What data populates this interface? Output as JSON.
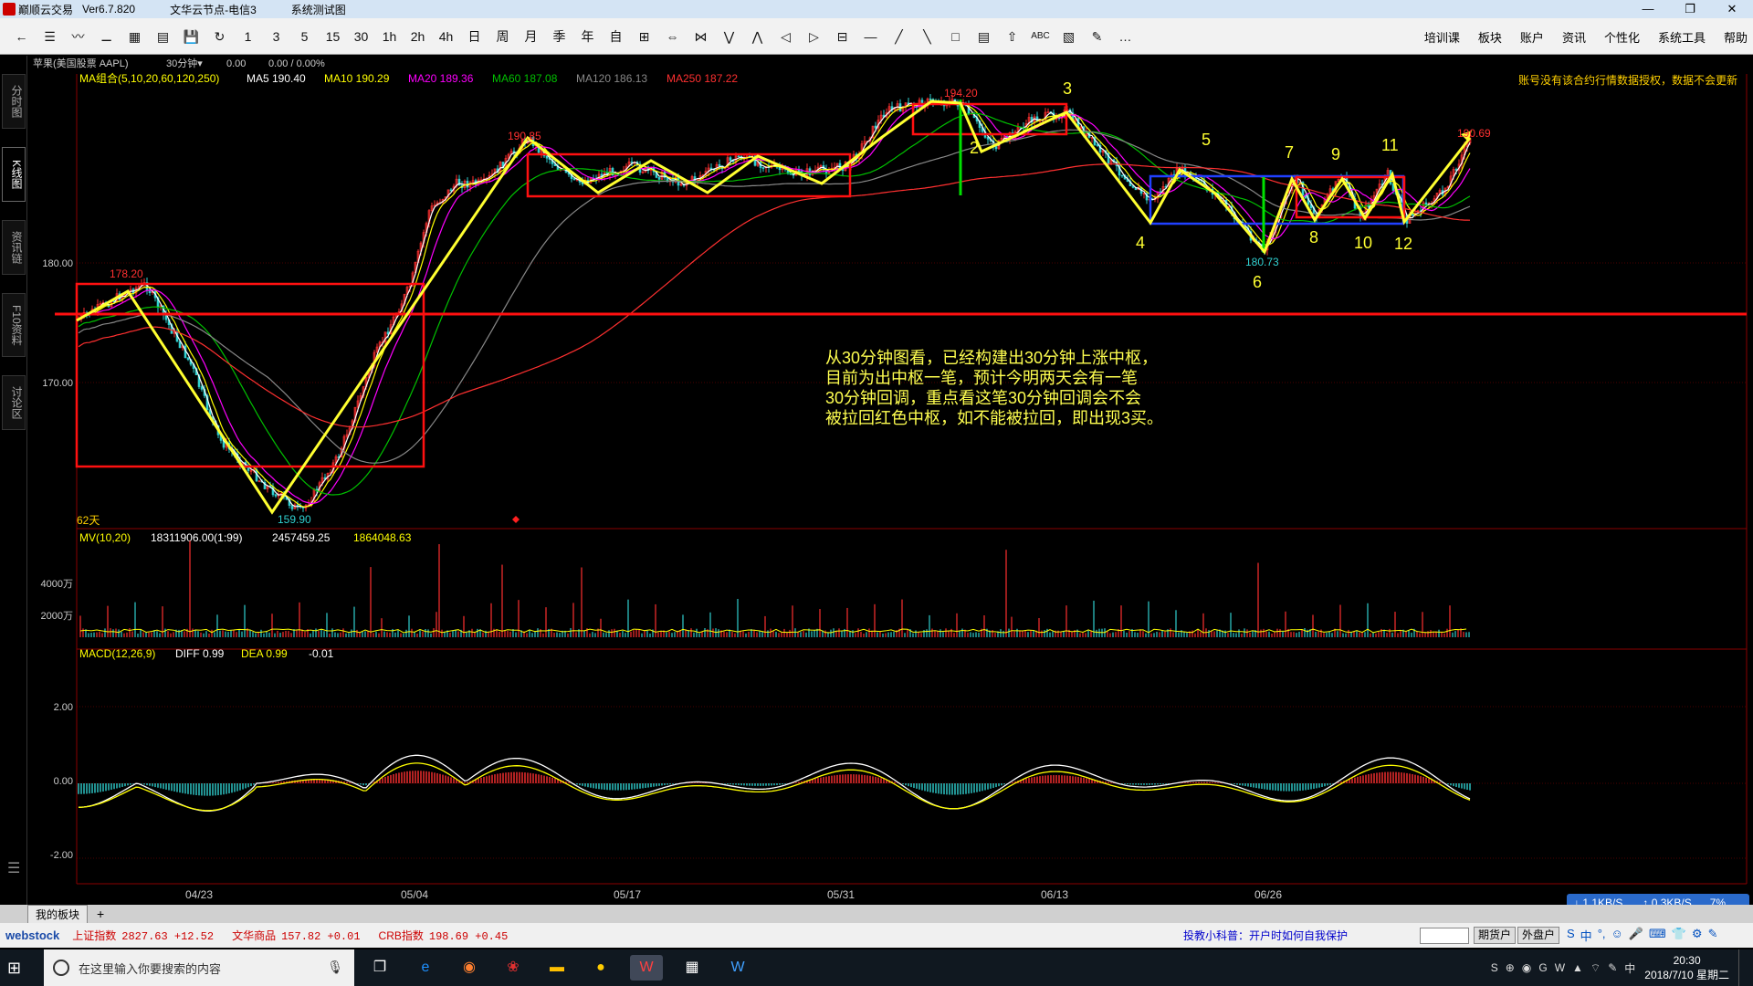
{
  "titlebar": {
    "app_name": "巅顺云交易",
    "version": "Ver6.7.820",
    "server": "文华云节点-电信3",
    "test": "系统测试图",
    "min": "—",
    "restore": "❐",
    "close": "✕"
  },
  "toolbar": {
    "buttons": [
      "←",
      "☰",
      "〰",
      "⚊",
      "▦",
      "▤",
      "💾",
      "↻",
      "1",
      "3",
      "5",
      "15",
      "30",
      "1h",
      "2h",
      "4h",
      "日",
      "周",
      "月",
      "季",
      "年",
      "自",
      "⊞",
      "⇔",
      "⋈",
      "⋁",
      "⋀",
      "◁",
      "▷",
      "⊟",
      "—",
      "╱",
      "╲",
      "□",
      "▤",
      "⇧",
      "ABC",
      "▧",
      "✎",
      "…"
    ],
    "menus": [
      "培训课",
      "板块",
      "账户",
      "资讯",
      "个性化",
      "系统工具",
      "帮助"
    ]
  },
  "sidebar": {
    "tabs": [
      "分时图",
      "K线图",
      "资讯链",
      "F10资料",
      "讨论区"
    ],
    "menu_icon": "☰"
  },
  "chart_header": {
    "symbol": "苹果(美国股票 AAPL)",
    "period": "30分钟▾",
    "val1": "0.00",
    "val2": "0.00 / 0.00%"
  },
  "ma_legend": {
    "label": "MA组合(5,10,20,60,120,250)",
    "ma5": "MA5 190.40",
    "ma10": "MA10 190.29",
    "ma20": "MA20 189.36",
    "ma60": "MA60 187.08",
    "ma120": "MA120 186.13",
    "ma250": "MA250 187.22"
  },
  "warning": "账号没有该合约行情数据授权，数据不会更新",
  "price_axis": [
    "180.00",
    "170.00"
  ],
  "price_labels": {
    "p1": "178.20",
    "p2": "159.90",
    "p3": "190.35",
    "p4": "194.20",
    "p5": "180.73",
    "p6": "190.69"
  },
  "day_count": "62天",
  "wave_numbers": [
    "2",
    "3",
    "4",
    "5",
    "6",
    "7",
    "8",
    "9",
    "10",
    "11",
    "12"
  ],
  "annotation": {
    "line1": "从30分钟图看，已经构建出30分钟上涨中枢，",
    "line2": "目前为出中枢一笔，预计今明两天会有一笔",
    "line3": "30分钟回调，重点看这笔30分钟回调会不会",
    "line4": "被拉回红色中枢，如不能被拉回，即出现3买。"
  },
  "volume": {
    "label": "MV(10,20)",
    "v1": "18311906.00(1:99)",
    "v2": "2457459.25",
    "v3": "1864048.63",
    "axis": [
      "4000万",
      "2000万"
    ]
  },
  "macd": {
    "label": "MACD(12,26,9)",
    "diff": "DIFF 0.99",
    "dea": "DEA 0.99",
    "macd": "-0.01",
    "axis": [
      "2.00",
      "0.00",
      "-2.00"
    ]
  },
  "dates": [
    "04/23",
    "05/04",
    "05/17",
    "05/31",
    "06/13",
    "06/26"
  ],
  "colors": {
    "up": "#ff3030",
    "down": "#30d0d0",
    "ma5": "#ffffff",
    "ma10": "#ffff00",
    "ma20": "#ff00ff",
    "ma60": "#00c000",
    "ma120": "#888888",
    "ma250": "#ff3030",
    "zhongshu": "#ff0000",
    "stroke": "#ffff30",
    "annotation": "#ffff50",
    "blue_box": "#2040ff",
    "green_line": "#00e000"
  },
  "bottom_tabs": {
    "tab": "我的板块",
    "plus": "+"
  },
  "status": {
    "logo": "webstock",
    "indices": [
      {
        "name": "上证指数",
        "val": "2827.63 +12.52"
      },
      {
        "name": "文华商品",
        "val": "157.82 +0.01"
      },
      {
        "name": "CRB指数",
        "val": "198.69 +0.45"
      }
    ],
    "tip": "投教小科普：开户时如何自我保护",
    "btn1": "期货户",
    "btn2": "外盘户",
    "icons": [
      "S",
      "中",
      "°,",
      "☺",
      "🎤",
      "⌨",
      "👕",
      "⚙",
      "✎"
    ]
  },
  "netspeed": {
    "down": "↓ 1.1KB/S",
    "up": "↑ 0.3KB/S",
    "pct": "7%"
  },
  "taskbar": {
    "search_placeholder": "在这里输入你要搜索的内容",
    "time": "20:30",
    "date": "2018/7/10 星期二",
    "ime": "中",
    "tray_icons": [
      "S",
      "⊕",
      "◉",
      "G",
      "W",
      "▲",
      "⌔",
      "✎"
    ]
  }
}
